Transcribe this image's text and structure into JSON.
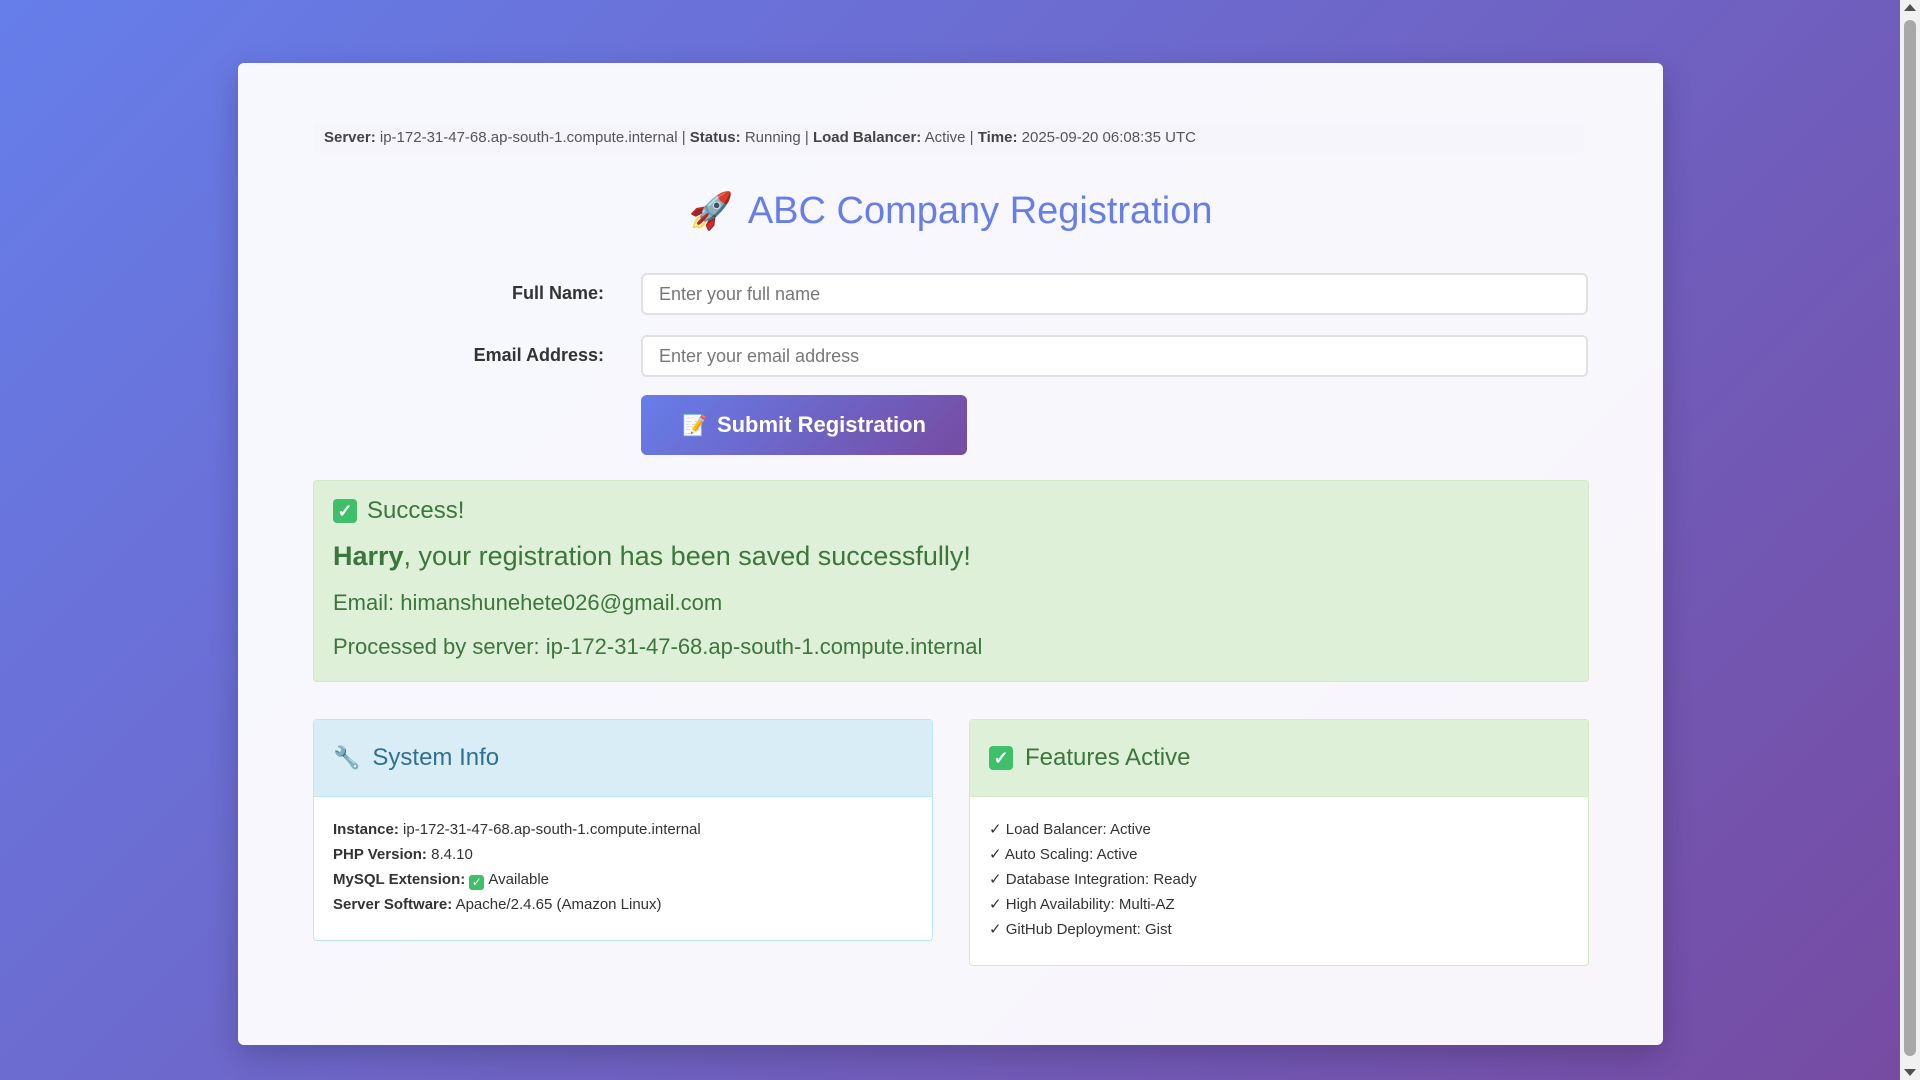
{
  "status_bar": {
    "server_label": "Server:",
    "server_value": "ip-172-31-47-68.ap-south-1.compute.internal",
    "sep1": " | ",
    "status_label": "Status:",
    "status_value": "Running",
    "sep2": " | ",
    "lb_label": "Load Balancer:",
    "lb_value": "Active",
    "sep3": " | ",
    "time_label": "Time:",
    "time_value": "2025-09-20 06:08:35 UTC"
  },
  "title": {
    "icon": "🚀",
    "text": "ABC Company Registration"
  },
  "form": {
    "name_label": "Full Name:",
    "name_placeholder": "Enter your full name",
    "name_value": "",
    "email_label": "Email Address:",
    "email_placeholder": "Enter your email address",
    "email_value": "",
    "submit_icon": "📝",
    "submit_label": "Submit Registration"
  },
  "success": {
    "heading": "Success!",
    "name": "Harry",
    "message": ", your registration has been saved successfully!",
    "email_line": "Email: himanshunehete026@gmail.com",
    "server_line": "Processed by server: ip-172-31-47-68.ap-south-1.compute.internal"
  },
  "system_info": {
    "heading": "System Info",
    "rows": [
      {
        "label": "Instance:",
        "value": "ip-172-31-47-68.ap-south-1.compute.internal"
      },
      {
        "label": "PHP Version:",
        "value": "8.4.10"
      },
      {
        "label": "MySQL Extension:",
        "value": "Available"
      },
      {
        "label": "Server Software:",
        "value": "Apache/2.4.65 (Amazon Linux)"
      }
    ]
  },
  "features": {
    "heading": "Features Active",
    "items": [
      "✓ Load Balancer: Active",
      "✓ Auto Scaling: Active",
      "✓ Database Integration: Ready",
      "✓ High Availability: Multi-AZ",
      "✓ GitHub Deployment: Gist"
    ]
  },
  "colors": {
    "accent": "#667eea",
    "accent_end": "#764ba2",
    "success_bg": "#dff0d8",
    "success_text": "#3c763d",
    "info_bg": "#d9edf7",
    "info_text": "#31708f"
  }
}
